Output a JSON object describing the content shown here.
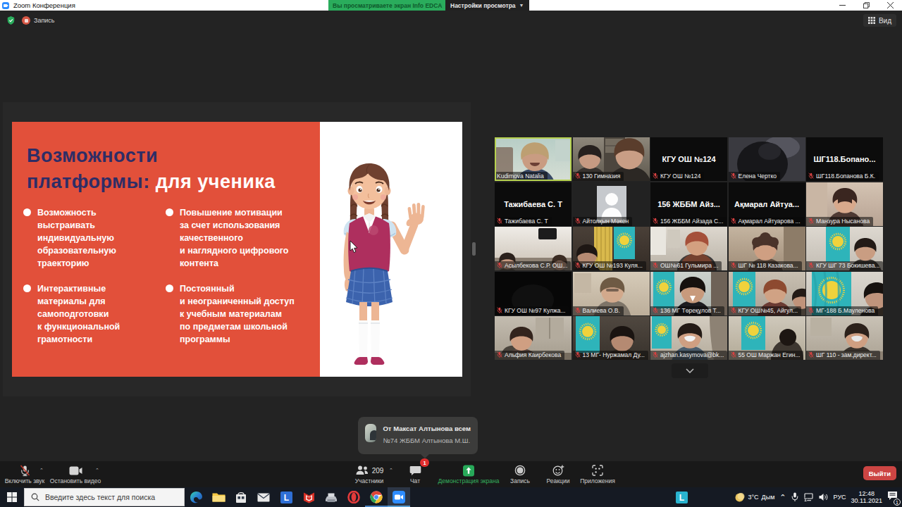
{
  "titlebar": {
    "app_title": "Zoom Конференция",
    "share_banner": "Вы просматриваете экран Info EDCA",
    "view_options_label": "Настройки просмотра",
    "window_buttons": [
      "minimize",
      "maximize",
      "close"
    ]
  },
  "meeting": {
    "recording_label": "Запись",
    "view_button_label": "Вид"
  },
  "slide": {
    "title_line1": "Возможности",
    "title_line2_bold": "платформы:",
    "title_line2_light": "для ученика",
    "accent_color": "#e2503a",
    "title_color": "#2e2d66",
    "bullets": [
      "Возможность\nвыстраивать\nиндивидуальную\nобразовательную\nтраекторию",
      "Повышение мотивации\nза счет использования\nкачественного\nи наглядного цифрового\nконтента",
      "Интерактивные\nматериалы для\nсамоподготовки\nк функциональной\nграмотности",
      "Постоянный\nи неограниченный доступ\nк учебным материалам\nпо предметам школьной\nпрограммы"
    ]
  },
  "participants": {
    "tiles": [
      {
        "name": "Kudimova Natalia",
        "muted": false,
        "active_speaker": true,
        "kind": "video",
        "scene": "speaker-teal"
      },
      {
        "name": "130  Гимназия",
        "muted": true,
        "active_speaker": false,
        "kind": "video",
        "scene": "two-women"
      },
      {
        "name": "КГУ ОШ №124",
        "muted": true,
        "active_speaker": false,
        "kind": "name",
        "center_name": "КГУ ОШ №124"
      },
      {
        "name": "Елена Чертко",
        "muted": true,
        "active_speaker": false,
        "kind": "video",
        "scene": "dark-closeup"
      },
      {
        "name": "ШГ118.Бопанова Б.К.",
        "muted": true,
        "active_speaker": false,
        "kind": "name",
        "center_name": "ШГ118.Бопано..."
      },
      {
        "name": "Тажибаева С. Т",
        "muted": true,
        "active_speaker": false,
        "kind": "name",
        "center_name": "Тажибаева С. Т"
      },
      {
        "name": "Айтолқын Мәкен",
        "muted": true,
        "active_speaker": false,
        "kind": "avatar",
        "scene": "avatar"
      },
      {
        "name": "156 ЖББМ Айзада С...",
        "muted": true,
        "active_speaker": false,
        "kind": "name",
        "center_name": "156 ЖББМ Айз..."
      },
      {
        "name": "Ақмарал Айтуарова ...",
        "muted": true,
        "active_speaker": false,
        "kind": "name",
        "center_name": "Ақмарал  Айтуа..."
      },
      {
        "name": "Манзура Нысанова",
        "muted": true,
        "active_speaker": false,
        "kind": "video",
        "scene": "woman-bright"
      },
      {
        "name": "Асылбекова С.Р. ОШ...",
        "muted": true,
        "active_speaker": false,
        "kind": "video",
        "scene": "classroom"
      },
      {
        "name": "КГУ ОШ №193 Куля...",
        "muted": true,
        "active_speaker": false,
        "kind": "video",
        "scene": "curtain-flag"
      },
      {
        "name": "ОШ№61 Гульмира ...",
        "muted": true,
        "active_speaker": false,
        "kind": "video",
        "scene": "office-redhair"
      },
      {
        "name": "ШГ № 118 Казакова...",
        "muted": true,
        "active_speaker": false,
        "kind": "video",
        "scene": "room-curly"
      },
      {
        "name": "КГУ ШГ 73 Бокишева...",
        "muted": true,
        "active_speaker": false,
        "kind": "video",
        "scene": "flag-woman"
      },
      {
        "name": "КГУ ОШ №97 Кулжа...",
        "muted": true,
        "active_speaker": false,
        "kind": "video",
        "scene": "near-black"
      },
      {
        "name": "Валиева О.В.",
        "muted": true,
        "active_speaker": false,
        "kind": "video",
        "scene": "beige-woman"
      },
      {
        "name": "136 МГ Төреқұлов Т...",
        "muted": true,
        "active_speaker": false,
        "kind": "video",
        "scene": "suit-flag"
      },
      {
        "name": "КГУ ОШ№45,  Айгул...",
        "muted": true,
        "active_speaker": false,
        "kind": "video",
        "scene": "flag-two"
      },
      {
        "name": "МГ-188 Б.Мауленова",
        "muted": true,
        "active_speaker": false,
        "kind": "video",
        "scene": "big-flag"
      },
      {
        "name": "Альфия Каирбекова",
        "muted": true,
        "active_speaker": false,
        "kind": "video",
        "scene": "desk-woman"
      },
      {
        "name": "13 МГ- Нуржамал Ду...",
        "muted": true,
        "active_speaker": false,
        "kind": "video",
        "scene": "flag-dark"
      },
      {
        "name": "ajzhan.kasymova@bk...",
        "muted": true,
        "active_speaker": false,
        "kind": "video",
        "scene": "mask-flag"
      },
      {
        "name": "55 ОШ Маржан Егин...",
        "muted": true,
        "active_speaker": false,
        "kind": "video",
        "scene": "flag-back"
      },
      {
        "name": "ШГ 110 - зам.директ...",
        "muted": true,
        "active_speaker": false,
        "kind": "video",
        "scene": "mask-desk"
      }
    ]
  },
  "chat_popup": {
    "title": "От Максат Алтынова всем",
    "message": "№74 ЖББМ Алтынова М.Ш."
  },
  "toolbar": {
    "unmute_label": "Включить звук",
    "stop_video_label": "Остановить видео",
    "participants_label": "Участники",
    "participants_count": "209",
    "chat_label": "Чат",
    "chat_badge": "1",
    "share_label": "Демонстрация экрана",
    "record_label": "Запись",
    "reactions_label": "Реакции",
    "apps_label": "Приложения",
    "leave_label": "Выйти",
    "accent_green": "#35b05f",
    "leave_red": "#cc4543"
  },
  "taskbar": {
    "search_placeholder": "Введите здесь текст для поиска",
    "pinned_icons": [
      "edge",
      "explorer",
      "store",
      "mail",
      "l-app",
      "mcafee",
      "fax",
      "opera",
      "chrome",
      "zoom"
    ],
    "center_icon": "l-app",
    "tray": {
      "weather_temp": "3°C",
      "weather_text": "Дым",
      "language": "РУС",
      "time": "12:48",
      "date": "30.11.2021",
      "notification_count": "1"
    }
  }
}
